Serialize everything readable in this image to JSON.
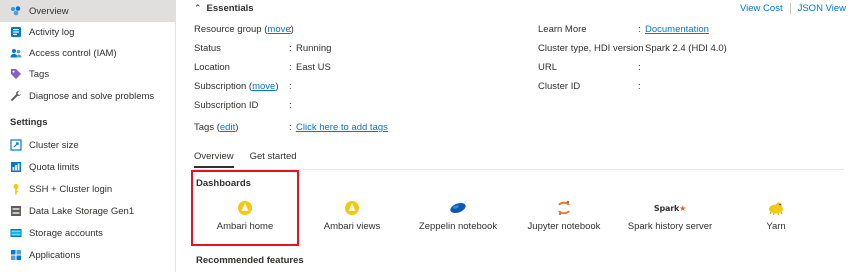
{
  "sidebar": {
    "items": [
      {
        "label": "Overview",
        "icon": "cloud-cluster-icon"
      },
      {
        "label": "Activity log",
        "icon": "activity-log-icon"
      },
      {
        "label": "Access control (IAM)",
        "icon": "people-icon"
      },
      {
        "label": "Tags",
        "icon": "tag-icon"
      },
      {
        "label": "Diagnose and solve problems",
        "icon": "wrench-icon"
      }
    ],
    "section_title": "Settings",
    "settings_items": [
      {
        "label": "Cluster size",
        "icon": "resize-icon"
      },
      {
        "label": "Quota limits",
        "icon": "quota-icon"
      },
      {
        "label": "SSH + Cluster login",
        "icon": "key-icon"
      },
      {
        "label": "Data Lake Storage Gen1",
        "icon": "storage-icon"
      },
      {
        "label": "Storage accounts",
        "icon": "storage-accounts-icon"
      },
      {
        "label": "Applications",
        "icon": "applications-icon"
      }
    ]
  },
  "essentials": {
    "title": "Essentials",
    "view_cost": "View Cost",
    "json_view": "JSON View",
    "left": [
      {
        "label": "Resource group",
        "link": "move",
        "value": ""
      },
      {
        "label": "Status",
        "value": "Running"
      },
      {
        "label": "Location",
        "value": "East US"
      },
      {
        "label": "Subscription",
        "link": "move",
        "value": ""
      },
      {
        "label": "Subscription ID",
        "value": ""
      }
    ],
    "tags": {
      "label": "Tags",
      "link": "edit",
      "value": "Click here to add tags"
    },
    "right": [
      {
        "label": "Learn More",
        "value": "Documentation"
      },
      {
        "label": "Cluster type, HDI version",
        "value": "Spark 2.4 (HDI 4.0)"
      },
      {
        "label": "URL",
        "value": ""
      },
      {
        "label": "Cluster ID",
        "value": ""
      }
    ]
  },
  "tabs": [
    "Overview",
    "Get started"
  ],
  "dashboards": {
    "title": "Dashboards",
    "items": [
      {
        "label": "Ambari home",
        "icon": "ambari-icon"
      },
      {
        "label": "Ambari views",
        "icon": "ambari-views-icon"
      },
      {
        "label": "Zeppelin notebook",
        "icon": "zeppelin-icon"
      },
      {
        "label": "Jupyter notebook",
        "icon": "jupyter-icon"
      },
      {
        "label": "Spark history server",
        "icon": "spark-icon",
        "logo_text": "Spark"
      },
      {
        "label": "Yarn",
        "icon": "yarn-icon"
      }
    ]
  },
  "recommended_title": "Recommended features"
}
